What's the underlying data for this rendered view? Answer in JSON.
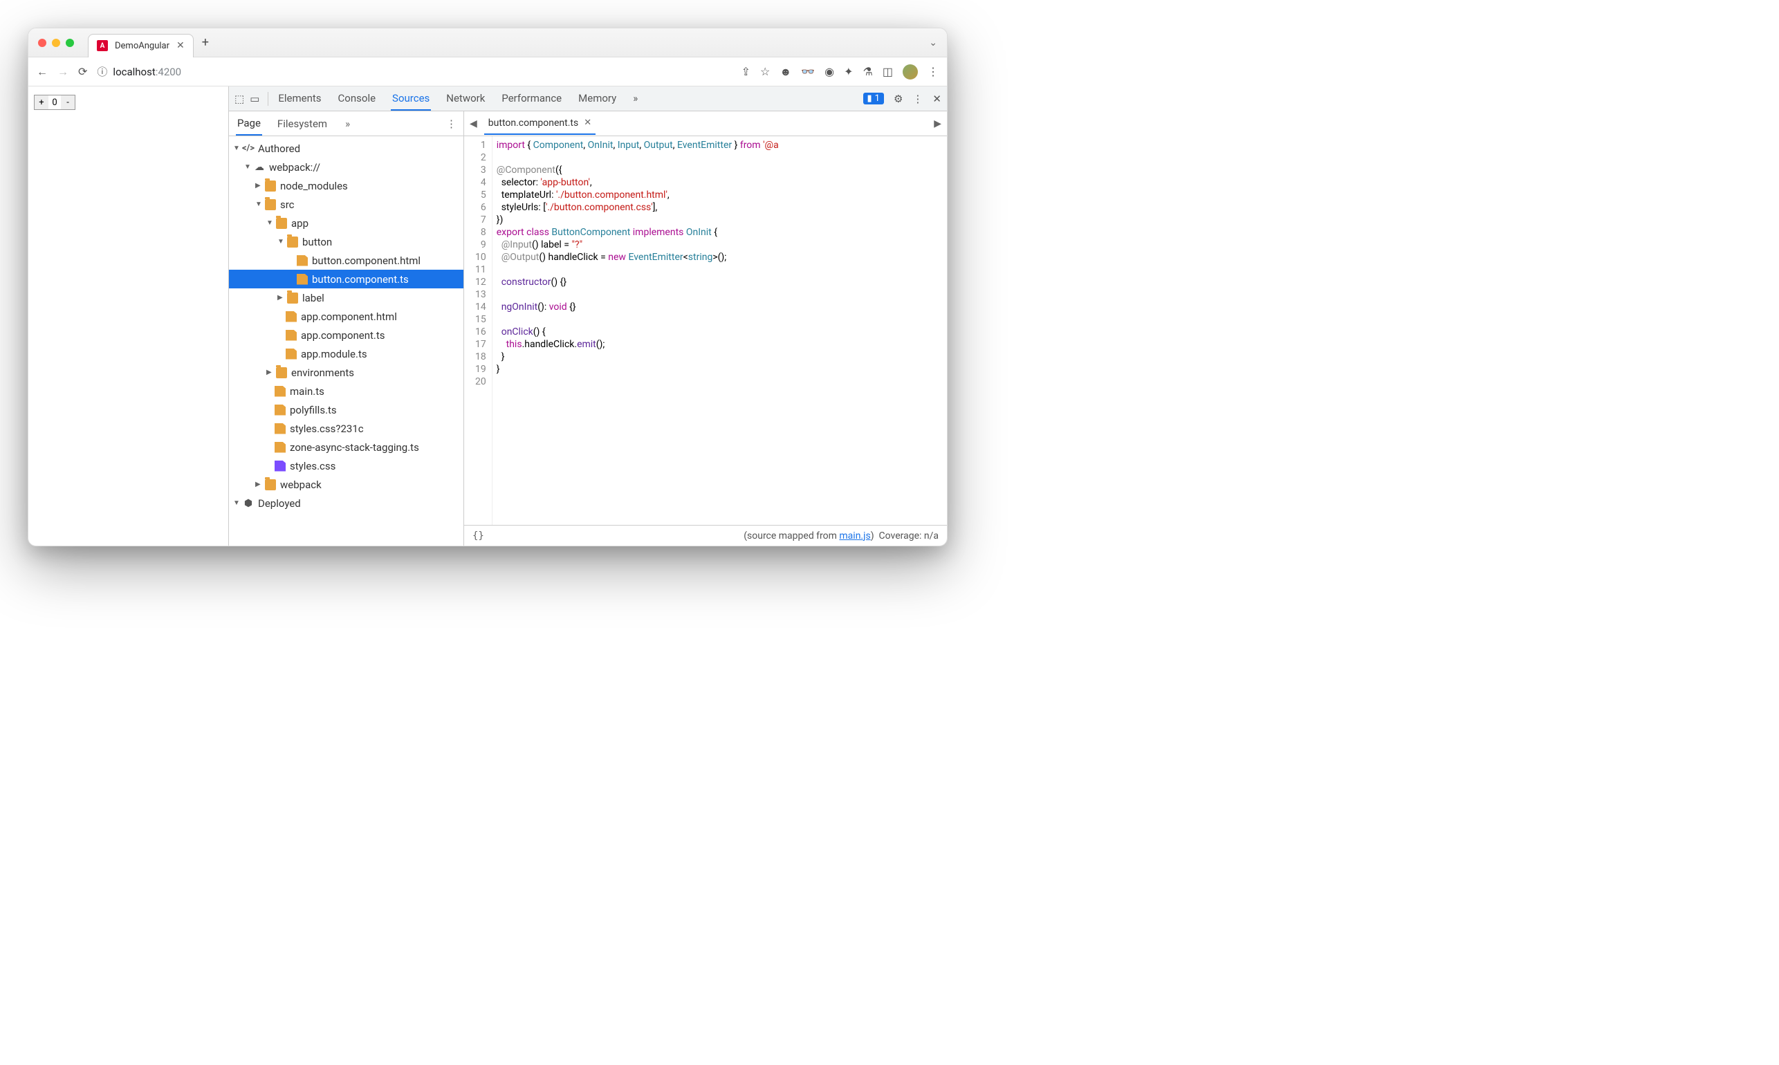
{
  "browser": {
    "tab_title": "DemoAngular",
    "url_host": "localhost",
    "url_port": ":4200",
    "counter_value": "0"
  },
  "devtools": {
    "tabs": [
      "Elements",
      "Console",
      "Sources",
      "Network",
      "Performance",
      "Memory"
    ],
    "active_tab": "Sources",
    "issues_count": "1",
    "sources_subtabs": [
      "Page",
      "Filesystem"
    ],
    "active_subtab": "Page",
    "open_file": "button.component.ts",
    "tree": {
      "authored": "Authored",
      "webpack": "webpack://",
      "node_modules": "node_modules",
      "src": "src",
      "app": "app",
      "button": "button",
      "button_html": "button.component.html",
      "button_ts": "button.component.ts",
      "label": "label",
      "app_html": "app.component.html",
      "app_ts": "app.component.ts",
      "app_module": "app.module.ts",
      "environments": "environments",
      "main_ts": "main.ts",
      "polyfills": "polyfills.ts",
      "styles_hash": "styles.css?231c",
      "zone": "zone-async-stack-tagging.ts",
      "styles": "styles.css",
      "webpack_folder": "webpack",
      "deployed": "Deployed"
    },
    "status": {
      "mapped_prefix": "(source mapped from ",
      "mapped_file": "main.js",
      "mapped_suffix": ")",
      "coverage": "Coverage: n/a"
    },
    "code_lines": 20
  }
}
